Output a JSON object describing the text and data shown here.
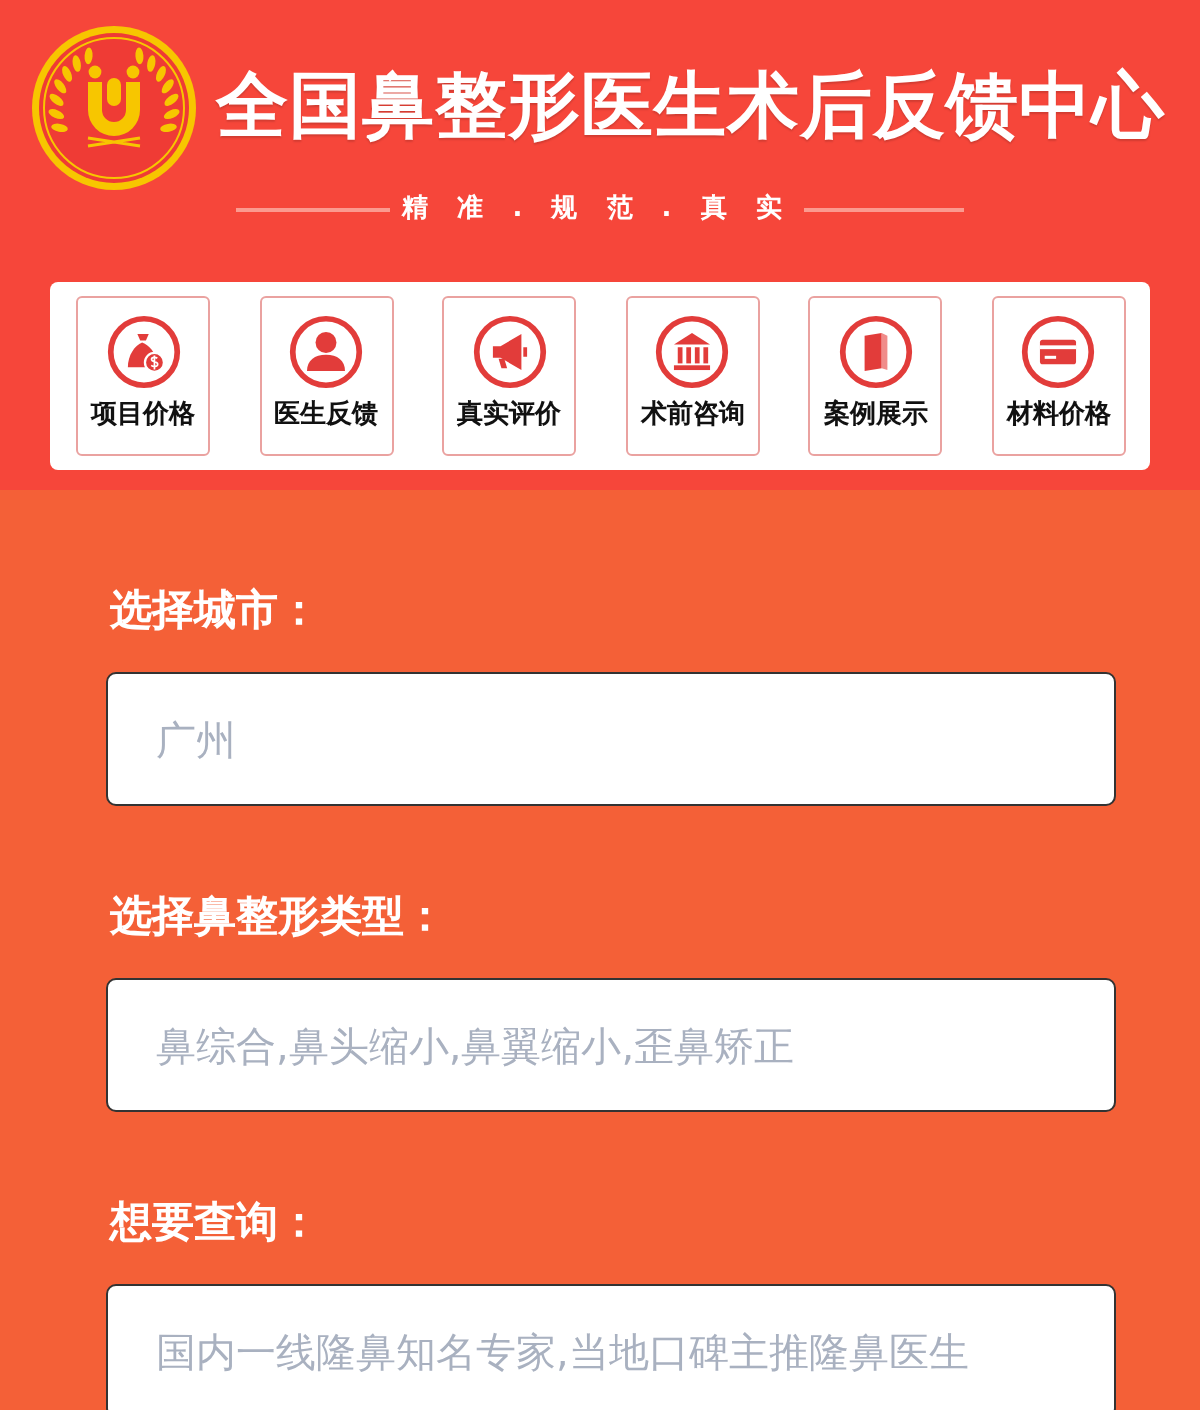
{
  "header": {
    "title": "全国鼻整形医生术后反馈中心",
    "slogan": "精 准 . 规 范 . 真 实"
  },
  "nav": [
    {
      "label": "项目价格"
    },
    {
      "label": "医生反馈"
    },
    {
      "label": "真实评价"
    },
    {
      "label": "术前咨询"
    },
    {
      "label": "案例展示"
    },
    {
      "label": "材料价格"
    }
  ],
  "form": [
    {
      "label": "选择城市：",
      "placeholder": "广州"
    },
    {
      "label": "选择鼻整形类型：",
      "placeholder": "鼻综合,鼻头缩小,鼻翼缩小,歪鼻矫正"
    },
    {
      "label": "想要查询：",
      "placeholder": "国内一线隆鼻知名专家,当地口碑主推隆鼻医生"
    }
  ]
}
